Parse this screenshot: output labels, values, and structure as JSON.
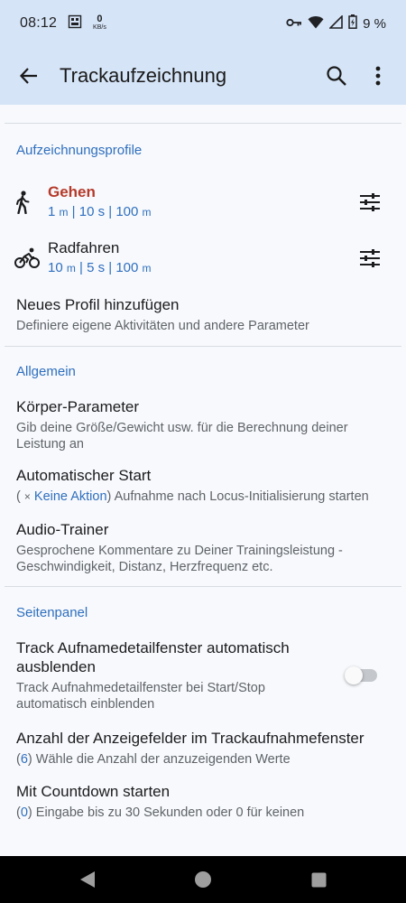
{
  "status_bar": {
    "time": "08:12",
    "speed_value": "0",
    "speed_unit": "KB/s",
    "battery_percent": "9 %"
  },
  "app_bar": {
    "title": "Trackaufzeichnung"
  },
  "sections": {
    "profiles_header": "Aufzeichnungsprofile",
    "general_header": "Allgemein",
    "sidepanel_header": "Seitenpanel"
  },
  "profiles": [
    {
      "name": "Gehen",
      "d1": "1",
      "u1": "m",
      "sep1": " | ",
      "d2": "10 s",
      "sep2": " | ",
      "d3": "100",
      "u3": "m",
      "icon": "walking-icon",
      "active": true
    },
    {
      "name": "Radfahren",
      "d1": "10",
      "u1": "m",
      "sep1": " | ",
      "d2": "5 s",
      "sep2": " | ",
      "d3": "100",
      "u3": "m",
      "icon": "bicycle-icon",
      "active": false
    }
  ],
  "add_profile": {
    "title": "Neues Profil hinzufügen",
    "subtitle": "Definiere eigene Aktivitäten und andere Parameter"
  },
  "general": {
    "body_title": "Körper-Parameter",
    "body_sub": "Gib deine Größe/Gewicht usw. für die Berechnung deiner Leistung an",
    "autostart_title": "Automatischer Start",
    "autostart_open": "( ",
    "autostart_x": "×",
    "autostart_value": " Keine Aktion",
    "autostart_rest": ") Aufnahme nach Locus-Initialisierung starten",
    "audio_title": "Audio-Trainer",
    "audio_sub": "Gesprochene Kommentare zu Deiner Trainingsleistung - Geschwindigkeit, Distanz, Herzfrequenz etc."
  },
  "sidepanel": {
    "autohide_title": "Track Aufnamedetailfenster automatisch ausblenden",
    "autohide_sub": "Track Aufnahmedetailfenster bei Start/Stop automatisch einblenden",
    "autohide_enabled": false,
    "fields_title": "Anzahl der Anzeigefelder im Trackaufnahmefenster",
    "fields_open": "(",
    "fields_value": "6",
    "fields_rest": ") Wähle die Anzahl der anzuzeigenden Werte",
    "countdown_title": "Mit Countdown starten",
    "countdown_open": "(",
    "countdown_value": "0",
    "countdown_rest": ") Eingabe bis zu 30 Sekunden oder 0 für keinen"
  },
  "colors": {
    "app_bar": "#d5e4f7",
    "accent": "#2f6fbf",
    "active_profile": "#b53a2b",
    "background": "#f7f9fc"
  }
}
